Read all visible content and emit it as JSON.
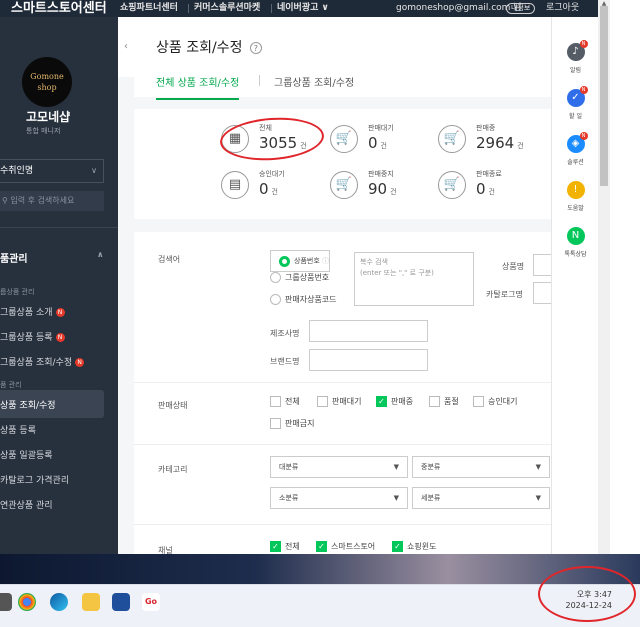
{
  "topbar": {
    "brand": "스마트스토어센터",
    "nav": [
      "쇼핑파트너센터",
      "커머스솔루션마켓",
      "네이버광고 ∨"
    ],
    "email": "gomoneshop@gmail.com 님",
    "tag": "내정보",
    "logout": "로그아웃"
  },
  "sidebar": {
    "logo_line1": "Gomone",
    "logo_line2": "shop",
    "shop_name": "고모네샵",
    "role": "통합 매니저",
    "select_value": "수취인명",
    "search_placeholder": "입력 후 검색하세요",
    "menu_head": "품관리",
    "items": [
      {
        "type": "cat",
        "label": "룹상품 관리"
      },
      {
        "type": "item",
        "label": "그룹상품 소개",
        "badge": "N"
      },
      {
        "type": "item",
        "label": "그룹상품 등록",
        "badge": "N"
      },
      {
        "type": "item",
        "label": "그룹상품 조회/수정",
        "badge": "N"
      },
      {
        "type": "cat",
        "label": "품 관리"
      },
      {
        "type": "item",
        "label": "상품 조회/수정",
        "active": true
      },
      {
        "type": "item",
        "label": "상품 등록"
      },
      {
        "type": "item",
        "label": "상품 일괄등록"
      },
      {
        "type": "item",
        "label": "카탈로그 가격관리"
      },
      {
        "type": "item",
        "label": "연관상품 관리"
      }
    ]
  },
  "main": {
    "title": "상품 조회/수정",
    "help": "?",
    "tabs": [
      "전체 상품 조회/수정",
      "그룹상품 조회/수정"
    ],
    "stats": [
      {
        "label": "전체",
        "value": "3055",
        "unit": "건",
        "icon": "grid-icon"
      },
      {
        "label": "판매대기",
        "value": "0",
        "unit": "건",
        "icon": "cart-clock-icon"
      },
      {
        "label": "판매중",
        "value": "2964",
        "unit": "건",
        "icon": "cart-icon"
      },
      {
        "label": "승인대기",
        "value": "0",
        "unit": "건",
        "icon": "document-icon"
      },
      {
        "label": "판매중지",
        "value": "90",
        "unit": "건",
        "icon": "cart-pause-icon"
      },
      {
        "label": "판매종료",
        "value": "0",
        "unit": "건",
        "icon": "cart-x-icon"
      }
    ],
    "filters": {
      "search_label": "검색어",
      "radios": [
        "상품번호",
        "그룹상품번호",
        "판매자상품코드"
      ],
      "multi_placeholder_1": "복수 검색",
      "multi_placeholder_2": "(enter 또는 \",\" 로 구분)",
      "product_name_label": "상품명",
      "catalog_label": "카탈로그명",
      "maker_label": "제조사명",
      "brand_label": "브랜드명",
      "status_label": "판매상태",
      "status_options": [
        {
          "label": "전체",
          "checked": false
        },
        {
          "label": "판매대기",
          "checked": false
        },
        {
          "label": "판매중",
          "checked": true
        },
        {
          "label": "품절",
          "checked": false
        },
        {
          "label": "승인대기",
          "checked": false
        }
      ],
      "status_extra": "판매금지",
      "category_label": "카테고리",
      "category_selects": [
        "대분류",
        "중분류",
        "소분류",
        "세분류"
      ],
      "channel_label": "채널",
      "channels": [
        {
          "label": "전체",
          "checked": true
        },
        {
          "label": "스마트스토어",
          "checked": true
        },
        {
          "label": "쇼핑윈도",
          "checked": true
        }
      ]
    }
  },
  "rightpanel": [
    {
      "label": "알림",
      "icon": "bell-icon",
      "badge": "N",
      "color": "#555c66"
    },
    {
      "label": "할 일",
      "icon": "check-icon",
      "badge": "N",
      "color": "#2f6ee8"
    },
    {
      "label": "솔루션",
      "icon": "solution-icon",
      "badge": "N",
      "color": "#1a8cff"
    },
    {
      "label": "도움말",
      "icon": "help-icon",
      "color": "#f2b200"
    },
    {
      "label": "톡톡상담",
      "icon": "talk-icon",
      "color": "#03c75a"
    }
  ],
  "taskbar": {
    "clock_time": "오후 3:47",
    "clock_date": "2024-12-24"
  }
}
